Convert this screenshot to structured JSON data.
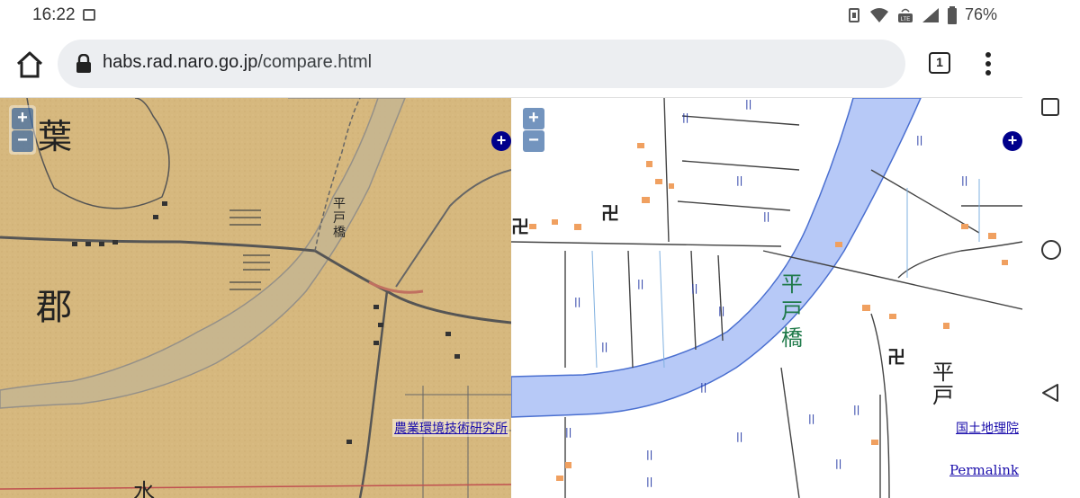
{
  "status_bar": {
    "time": "16:22",
    "battery": "76%",
    "icons": [
      "image-icon",
      "vibrate-icon",
      "wifi-icon",
      "volte-icon",
      "signal-icon",
      "battery-icon"
    ]
  },
  "browser": {
    "url_domain": "habs.rad.naro.go.jp",
    "url_path": "/compare.html",
    "tab_count": "1",
    "icons": [
      "home-icon",
      "lock-icon",
      "tabs-icon",
      "more-vert-icon"
    ]
  },
  "left_map": {
    "zoom_in": "+",
    "zoom_out": "−",
    "layers_button": "+",
    "attribution": "農業環境技術研究所",
    "labels": [
      "葉",
      "郡",
      "平戸橋",
      "水"
    ]
  },
  "right_map": {
    "zoom_in": "+",
    "zoom_out": "−",
    "layers_button": "+",
    "attribution": "国土地理院",
    "permalink": "Permalink",
    "labels": [
      "平戸橋",
      "平戸"
    ]
  },
  "nav_bar": {
    "icons": [
      "recents-icon",
      "home-circle-icon",
      "back-icon"
    ]
  },
  "colors": {
    "river": "#b7c9f7",
    "paper": "#d6b87e",
    "road_orange": "#f0a060"
  }
}
